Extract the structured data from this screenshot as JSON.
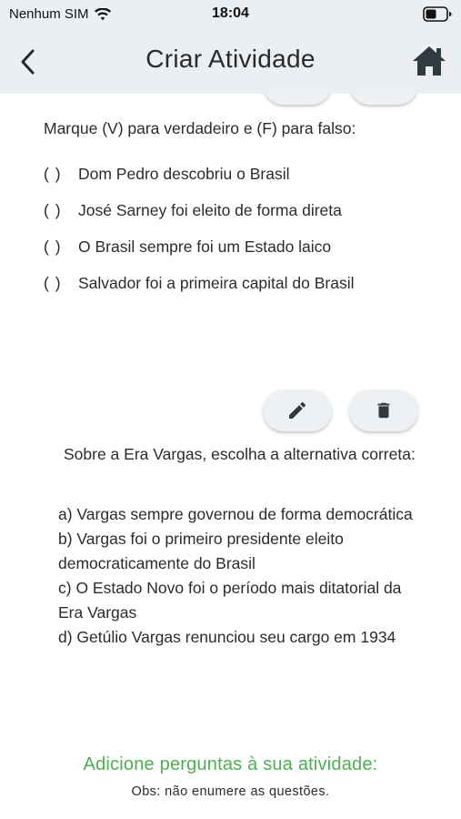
{
  "status_bar": {
    "carrier": "Nenhum SIM",
    "time": "18:04"
  },
  "nav": {
    "title": "Criar Atividade",
    "back_icon": "chevron-left-icon",
    "home_icon": "home-icon"
  },
  "questions": [
    {
      "text": "Marque (V) para verdadeiro e (F) para falso:",
      "option_marker": "( )",
      "options": [
        "Dom Pedro descobriu o Brasil",
        "José Sarney foi eleito de forma direta",
        "O Brasil sempre foi um Estado laico",
        "Salvador foi a primeira capital do Brasil"
      ]
    },
    {
      "text": "Sobre a Era Vargas, escolha a alternativa correta:",
      "options": [
        "a) Vargas sempre governou de forma democrática",
        "b) Vargas foi o primeiro presidente eleito democraticamente do Brasil",
        "c) O Estado Novo foi o período mais ditatorial da Era Vargas",
        "d) Getúlio Vargas renunciou seu cargo em 1934"
      ]
    }
  ],
  "actions": {
    "edit_icon": "pencil-icon",
    "delete_icon": "trash-icon"
  },
  "footer": {
    "add_title": "Adicione perguntas à sua atividade:",
    "note": "Obs: não enumere as questões."
  },
  "colors": {
    "header_bg": "#ebeff2",
    "accent_green": "#4caf50",
    "icon_dark": "#2f3b3f"
  }
}
